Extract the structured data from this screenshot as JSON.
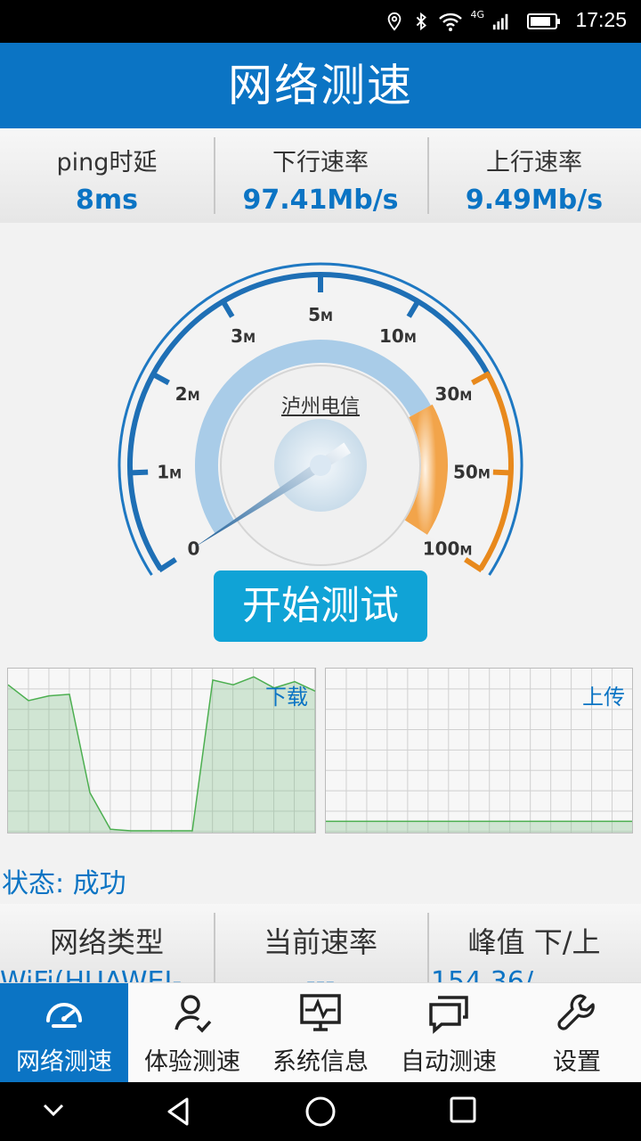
{
  "status_bar": {
    "time": "17:25",
    "network_label": "4G",
    "icons": [
      "location-icon",
      "bluetooth-icon",
      "wifi-icon",
      "cellular-signal-icon",
      "battery-icon"
    ]
  },
  "header": {
    "title": "网络测速"
  },
  "stats": [
    {
      "label": "ping时延",
      "value": "8ms"
    },
    {
      "label": "下行速率",
      "value": "97.41Mb/s"
    },
    {
      "label": "上行速率",
      "value": "9.49Mb/s"
    }
  ],
  "gauge": {
    "carrier": "泸州电信",
    "ticks": [
      "0",
      "1M",
      "2M",
      "3M",
      "5M",
      "10M",
      "30M",
      "50M",
      "100M"
    ],
    "current_tick_index": 0
  },
  "start_button": {
    "label": "开始测试"
  },
  "graphs": {
    "download": {
      "label": "下载",
      "values": [
        0.92,
        0.82,
        0.85,
        0.86,
        0.24,
        0.01,
        0.0,
        0.0,
        0.0,
        0.0,
        0.95,
        0.92,
        0.97,
        0.9,
        0.94,
        0.88
      ]
    },
    "upload": {
      "label": "上传",
      "values": [
        0.06,
        0.06,
        0.06,
        0.06,
        0.06,
        0.06,
        0.06,
        0.06,
        0.06,
        0.06,
        0.06,
        0.06,
        0.06,
        0.06,
        0.06,
        0.06
      ]
    }
  },
  "status": {
    "label": "状态: ",
    "value": "成功"
  },
  "info": {
    "network_type": {
      "header": "网络类型",
      "value": "WiFi(HUAWEI-"
    },
    "current_speed": {
      "header": "当前速率",
      "value": "---"
    },
    "peak": {
      "header": "峰值  下/上",
      "value": "154.36/"
    }
  },
  "nav": [
    {
      "label": "网络测速",
      "icon": "speedometer-icon",
      "active": true
    },
    {
      "label": "体验测速",
      "icon": "user-check-icon",
      "active": false
    },
    {
      "label": "系统信息",
      "icon": "monitor-pulse-icon",
      "active": false
    },
    {
      "label": "自动测速",
      "icon": "chat-windows-icon",
      "active": false
    },
    {
      "label": "设置",
      "icon": "wrench-icon",
      "active": false
    }
  ],
  "colors": {
    "primary": "#0b74c4",
    "accent_orange": "#e8891c",
    "button": "#10a3d6",
    "graph_line": "#4caf50"
  }
}
